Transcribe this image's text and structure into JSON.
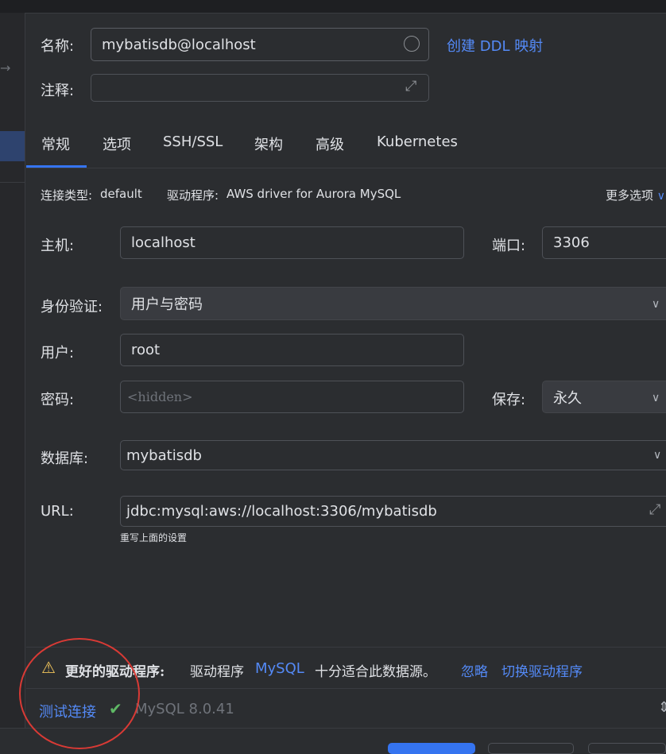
{
  "name_row": {
    "label": "名称:",
    "value": "mybatisdb@localhost",
    "ddl_link": "创建 DDL 映射"
  },
  "comment_row": {
    "label": "注释:",
    "value": ""
  },
  "tabs": [
    "常规",
    "选项",
    "SSH/SSL",
    "架构",
    "高级",
    "Kubernetes"
  ],
  "info": {
    "conn_type_label": "连接类型:",
    "conn_type_value": "default",
    "driver_label": "驱动程序:",
    "driver_value": "AWS driver for Aurora MySQL",
    "more_options": "更多选项"
  },
  "host": {
    "label": "主机:",
    "value": "localhost"
  },
  "port": {
    "label": "端口:",
    "value": "3306"
  },
  "auth": {
    "label": "身份验证:",
    "value": "用户与密码"
  },
  "user": {
    "label": "用户:",
    "value": "root"
  },
  "password": {
    "label": "密码:",
    "placeholder": "<hidden>"
  },
  "save": {
    "label": "保存:",
    "value": "永久"
  },
  "database": {
    "label": "数据库:",
    "value": "mybatisdb"
  },
  "url": {
    "label": "URL:",
    "value": "jdbc:mysql:aws://localhost:3306/mybatisdb",
    "hint": "重写上面的设置"
  },
  "warning": {
    "title": "更好的驱动程序:",
    "text_before": "驱动程序",
    "driver_link": "MySQL",
    "text_after": "十分适合此数据源。",
    "ignore": "忽略",
    "switch": "切换驱动程序"
  },
  "test": {
    "label": "测试连接",
    "result": "MySQL 8.0.41"
  },
  "colors": {
    "accent": "#3574f0",
    "link": "#548af7",
    "success": "#5fb865",
    "warning": "#f2c55c",
    "annotation": "#d93a35"
  },
  "icons": [
    "arrow-right-icon",
    "status-circle-icon",
    "expand-icon",
    "chevron-down-icon",
    "warning-icon",
    "check-icon"
  ]
}
